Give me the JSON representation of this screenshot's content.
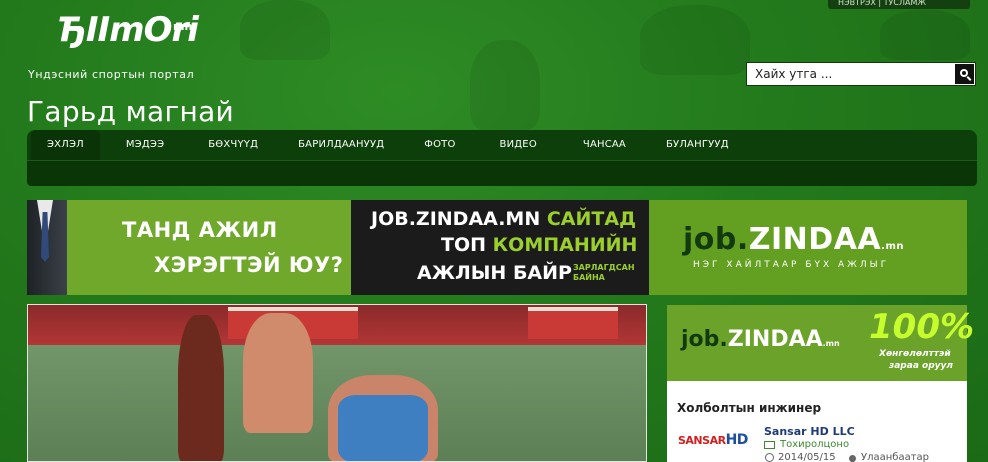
{
  "header": {
    "toplinks": "НЭВТРЭХ | ТУСЛАМЖ",
    "logo_text": "ЂIImOri",
    "logo_suffix": "mn",
    "tagline": "Үндэсний спортын портал",
    "search_placeholder": "Хайх утга ..."
  },
  "page_title": "Гарьд магнай",
  "nav": {
    "items": [
      {
        "label": "ЭХЛЭЛ",
        "active": true
      },
      {
        "label": "МЭДЭЭ",
        "active": false
      },
      {
        "label": "БӨХЧҮҮД",
        "active": false
      },
      {
        "label": "БАРИЛДААНУУД",
        "active": false
      },
      {
        "label": "ФОТО",
        "active": false
      },
      {
        "label": "ВИДЕО",
        "active": false
      },
      {
        "label": "ЧАНСАА",
        "active": false
      },
      {
        "label": "БУЛАНГУУД",
        "active": false
      }
    ]
  },
  "banner": {
    "left_line1": "ТАНД АЖИЛ",
    "left_line2": "ХЭРЭГТЭЙ ЮУ?",
    "mid_line1_a": "JOB.ZINDAA.MN",
    "mid_line1_b": "САЙТАД",
    "mid_line2_a": "ТОП",
    "mid_line2_b": "КОМПАНИЙН",
    "mid_line3": "АЖЛЫН БАЙР",
    "mid_line3_small": "ЗАРЛАГДСАН БАЙНА",
    "right_logo_j": "job.",
    "right_logo_rest": "ZINDAA",
    "right_logo_mn": ".mn",
    "right_sub": "НЭГ ХАЙЛТААР БҮХ АЖЛЫГ"
  },
  "side_ad": {
    "logo_j": "job.",
    "logo_rest": "ZINDAA",
    "logo_mn": ".mn",
    "percent": "100%",
    "line1": "Хөнгөлөлттэй",
    "line2": "зараа оруул"
  },
  "job_card": {
    "title": "Холболтын инжинер",
    "logo_a": "SANSAR",
    "logo_b": "HD",
    "company": "Sansar HD LLC",
    "status": "Тохиролцоно",
    "date": "2014/05/15",
    "location": "Улаанбаатар"
  },
  "colors": {
    "background": "#237a1c",
    "navbar": "#0d3f0a",
    "banner_green": "#6fa82a",
    "accent_lime": "#9bd02c"
  }
}
